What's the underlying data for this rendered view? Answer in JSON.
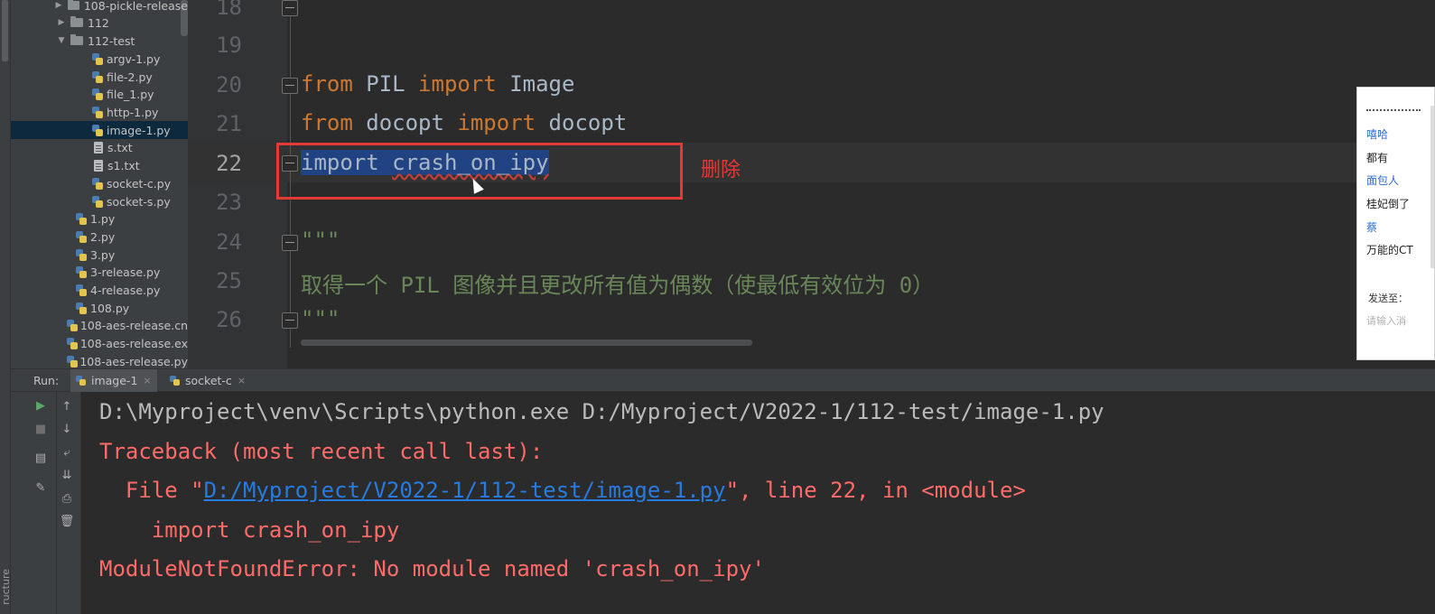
{
  "left_strip": {
    "vertical_label": "ructure"
  },
  "project_tree": {
    "items": [
      {
        "type": "folder",
        "expanded": false,
        "label": "108-pickle-release"
      },
      {
        "type": "folder",
        "expanded": false,
        "label": "112"
      },
      {
        "type": "folder",
        "expanded": true,
        "label": "112-test"
      },
      {
        "type": "py",
        "label": "argv-1.py"
      },
      {
        "type": "py",
        "label": "file-2.py"
      },
      {
        "type": "py",
        "label": "file_1.py"
      },
      {
        "type": "py",
        "label": "http-1.py"
      },
      {
        "type": "py",
        "label": "image-1.py",
        "selected": true
      },
      {
        "type": "txt",
        "label": "s.txt"
      },
      {
        "type": "txt",
        "label": "s1.txt"
      },
      {
        "type": "py",
        "label": "socket-c.py"
      },
      {
        "type": "py",
        "label": "socket-s.py"
      },
      {
        "type": "py",
        "label": "1.py"
      },
      {
        "type": "py",
        "label": "2.py"
      },
      {
        "type": "py",
        "label": "3.py"
      },
      {
        "type": "py",
        "label": "3-release.py"
      },
      {
        "type": "py",
        "label": "4-release.py"
      },
      {
        "type": "py",
        "label": "108.py"
      },
      {
        "type": "py",
        "label": "108-aes-release.cn"
      },
      {
        "type": "py",
        "label": "108-aes-release.ex"
      },
      {
        "type": "py",
        "label": "108-aes-release.py"
      }
    ]
  },
  "editor": {
    "line_numbers": [
      "18",
      "19",
      "20",
      "21",
      "22",
      "23",
      "24",
      "25",
      "26"
    ],
    "current_line": "22",
    "lines": {
      "l18": "\"\"\"",
      "l20_kw1": "from",
      "l20_mod": " PIL ",
      "l20_kw2": "import",
      "l20_name": " Image",
      "l21_kw1": "from",
      "l21_mod": " docopt ",
      "l21_kw2": "import",
      "l21_name": " docopt",
      "l22_kw": "import",
      "l22_space": " ",
      "l22_mod": "crash_on_ipy",
      "l24": "\"\"\"",
      "l25": "取得一个 PIL 图像并且更改所有值为偶数（使最低有效位为 0）",
      "l26": "\"\"\""
    },
    "annotation": "删除",
    "annotation_color": "#e53935"
  },
  "chat_popup": {
    "lines": [
      {
        "kind": "name",
        "text": "嘻哈"
      },
      {
        "kind": "msg",
        "text": "都有"
      },
      {
        "kind": "name",
        "text": "面包人"
      },
      {
        "kind": "msg",
        "text": "桂妃倒了"
      },
      {
        "kind": "name",
        "text": "蔡"
      },
      {
        "kind": "msg",
        "text": "万能的CT"
      }
    ],
    "send_to": "发送至：",
    "input_placeholder": "请输入消"
  },
  "run_panel": {
    "label": "Run:",
    "tabs": [
      {
        "label": "image-1",
        "close": "×",
        "active": true
      },
      {
        "label": "socket-c",
        "close": "×",
        "active": false
      }
    ],
    "toolbar_icons": [
      "run-icon",
      "up-arrow-icon",
      "stop-icon",
      "down-arrow-icon",
      "layout-icon",
      "soft-wrap-icon",
      "scroll-to-end-icon",
      "pin-icon",
      "print-icon",
      "trash-icon"
    ],
    "console": {
      "command": "D:\\Myproject\\venv\\Scripts\\python.exe D:/Myproject/V2022-1/112-test/image-1.py",
      "traceback_header": "Traceback (most recent call last):",
      "file_prefix": "  File \"",
      "file_link": "D:/Myproject/V2022-1/112-test/image-1.py",
      "file_suffix": "\", line 22, in <module>",
      "code_line": "    import crash_on_ipy",
      "error": "ModuleNotFoundError: No module named 'crash_on_ipy'"
    }
  },
  "colors": {
    "keyword": "#cc7832",
    "docstring": "#6a8759",
    "selection": "#214283",
    "error_text": "#ff6b68",
    "link": "#287bde"
  }
}
